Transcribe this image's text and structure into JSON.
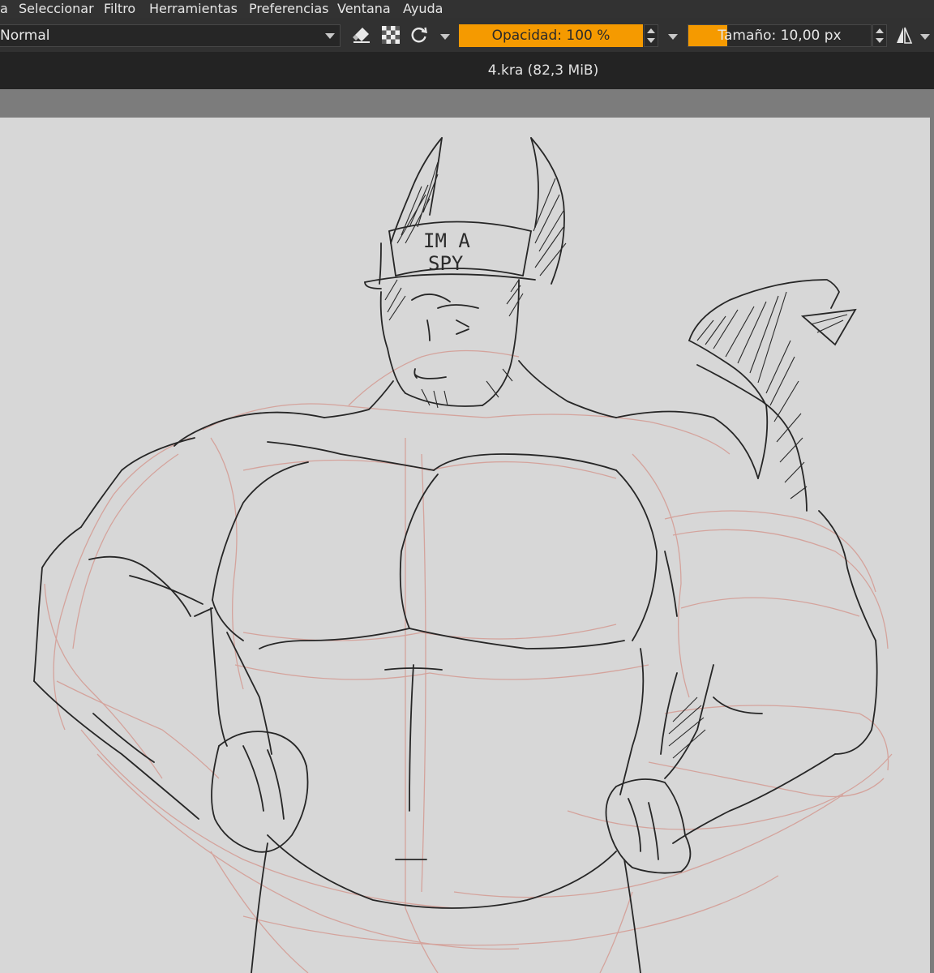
{
  "menu": {
    "items": [
      "a",
      "Seleccionar",
      "Filtro",
      "Herramientas",
      "Preferencias",
      "Ventana",
      "Ayuda"
    ]
  },
  "toolbar": {
    "blend_mode": "Normal",
    "opacity_label": "Opacidad: 100 %",
    "size_label": "Tamaño: 10,00 px",
    "icons": [
      "eraser-icon",
      "transparency-icon",
      "reload-icon",
      "mirror-icon"
    ],
    "accent_color": "#f59a00"
  },
  "document": {
    "title": "4.kra (82,3 MiB)"
  },
  "sketch": {
    "cap_text_line1": "IM  A",
    "cap_text_line2": "SPY"
  }
}
